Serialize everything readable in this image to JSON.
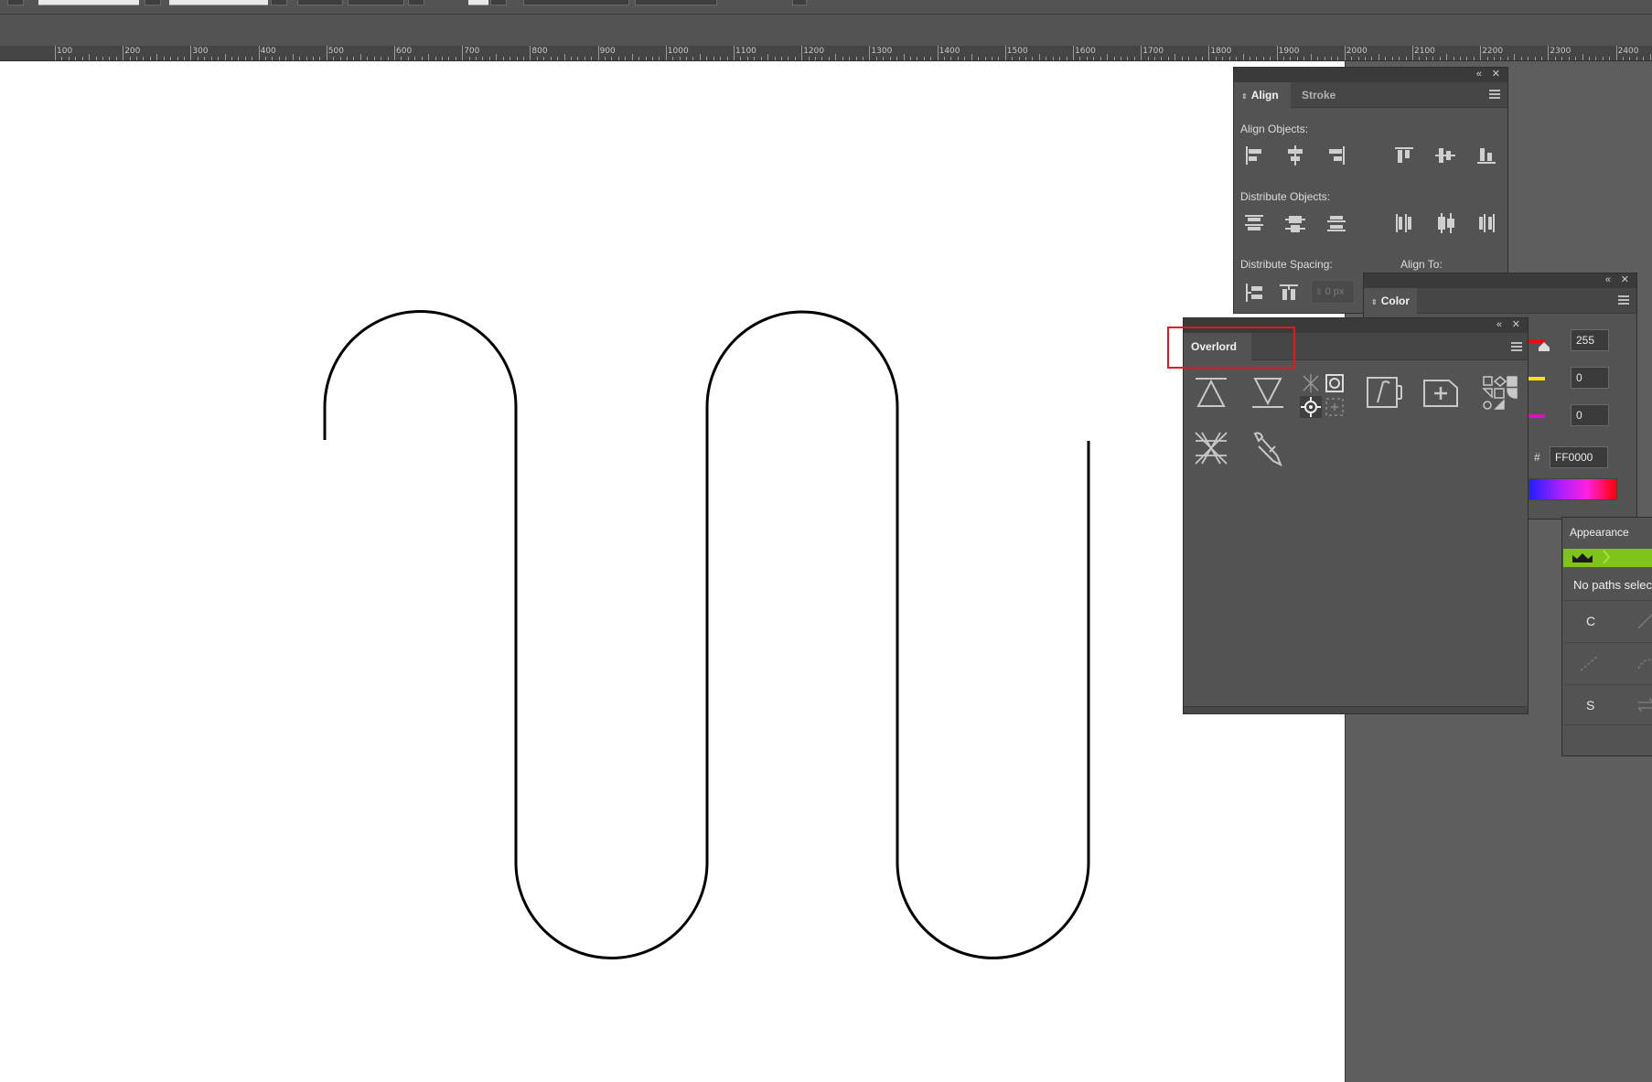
{
  "ruler": {
    "labels": [
      "100",
      "200",
      "300",
      "400",
      "500",
      "600",
      "700",
      "800",
      "900",
      "1000",
      "1100",
      "1200",
      "1300",
      "1400",
      "1500",
      "1600",
      "1700",
      "1800",
      "1900",
      "2000",
      "2100",
      "2200",
      "2300",
      "2400"
    ]
  },
  "align_panel": {
    "tabs": [
      "Align",
      "Stroke"
    ],
    "align_objects_label": "Align Objects:",
    "distribute_objects_label": "Distribute Objects:",
    "distribute_spacing_label": "Distribute Spacing:",
    "align_to_label": "Align To:",
    "spacing_value": "0 px",
    "align_icons": [
      "align-left-icon",
      "align-horizontal-center-icon",
      "align-right-icon",
      "align-top-icon",
      "align-vertical-center-icon",
      "align-bottom-icon"
    ],
    "distribute_icons": [
      "distribute-top-icon",
      "distribute-vertical-center-icon",
      "distribute-bottom-icon",
      "distribute-left-icon",
      "distribute-horizontal-center-icon",
      "distribute-right-icon"
    ]
  },
  "color_panel": {
    "tab": "Color",
    "r_value": "255",
    "g_value": "0",
    "b_value": "0",
    "hash": "#",
    "hex_value": "FF0000",
    "colors": {
      "red": "#e01010",
      "yellow": "#f2e500",
      "magenta": "#e010c0"
    }
  },
  "overlord_panel": {
    "tab": "Overlord",
    "tools": [
      "push-up-icon",
      "pull-down-icon",
      "target-selection-icon",
      "link-edit-icon",
      "add-artboard-icon",
      "grid-shapes-icon",
      "disconnect-icon",
      "pen-pipette-icon"
    ]
  },
  "appearance_panel": {
    "tab": "Appearance",
    "status": "No paths selec",
    "row1_label": "C",
    "row3_label": "S",
    "accent": "#7ec41a"
  },
  "colors": {
    "highlight": "#e8141e",
    "panel_bg": "#535353"
  }
}
